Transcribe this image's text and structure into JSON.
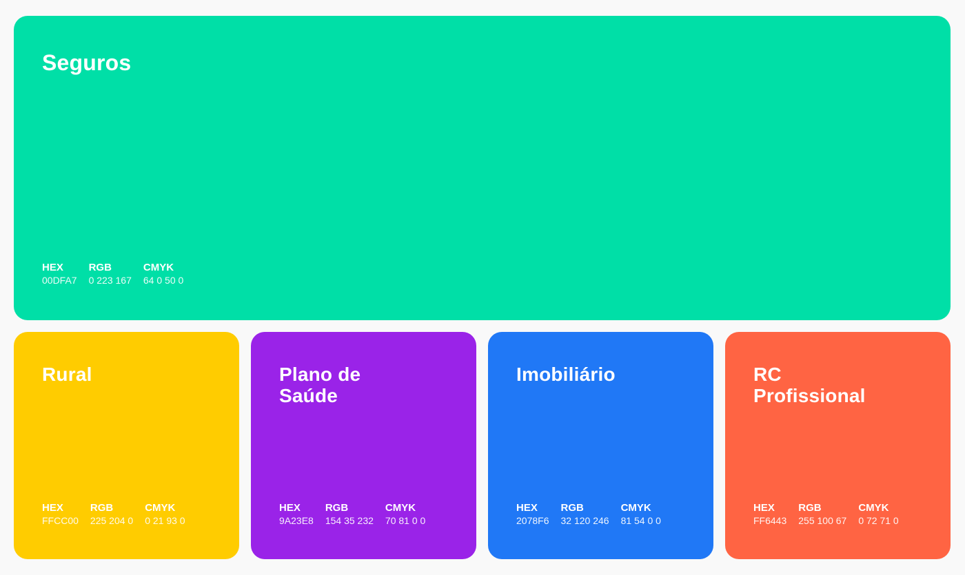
{
  "labels": {
    "hex": "HEX",
    "rgb": "RGB",
    "cmyk": "CMYK"
  },
  "cards": [
    {
      "title": "Seguros",
      "color": "#00DFA7",
      "hex": "00DFA7",
      "rgb": "0 223 167",
      "cmyk": "64 0 50 0"
    },
    {
      "title": "Rural",
      "color": "#FFCC00",
      "hex": "FFCC00",
      "rgb": "225 204 0",
      "cmyk": "0 21 93 0"
    },
    {
      "title": "Plano de\nSaúde",
      "color": "#9A23E8",
      "hex": "9A23E8",
      "rgb": "154 35 232",
      "cmyk": "70 81 0 0"
    },
    {
      "title": "Imobiliário",
      "color": "#2078F6",
      "hex": "2078F6",
      "rgb": "32 120 246",
      "cmyk": "81 54 0 0"
    },
    {
      "title": "RC\nProfissional",
      "color": "#FF6443",
      "hex": "FF6443",
      "rgb": "255 100 67",
      "cmyk": "0 72 71 0"
    }
  ]
}
